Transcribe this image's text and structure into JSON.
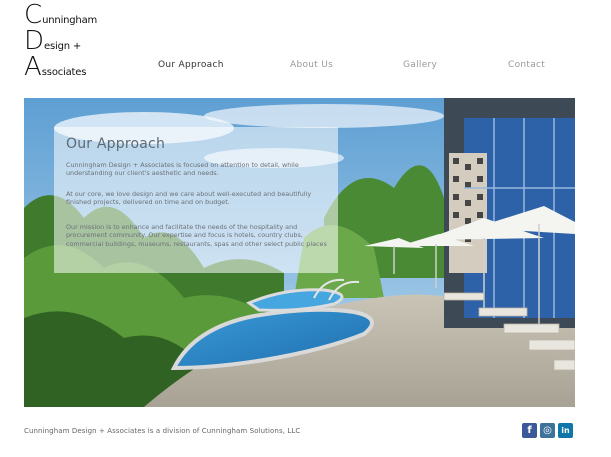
{
  "logo": {
    "line1_initial": "C",
    "line1_rest": "unningham",
    "line2_initial": "D",
    "line2_rest": "esign +",
    "line3_initial": "A",
    "line3_rest": "ssociates"
  },
  "nav": {
    "items": [
      {
        "label": "Our Approach",
        "active": true
      },
      {
        "label": "About Us",
        "active": false
      },
      {
        "label": "Gallery",
        "active": false
      },
      {
        "label": "Contact",
        "active": false
      }
    ]
  },
  "hero": {
    "title": "Our Approach",
    "paragraphs": [
      "Cunningham Design + Associates is focused on attention to detail, while understanding our client's aesthetic and needs.",
      "At our core, we love design and we care about well-executed and beautifully finished projects, delivered on time and on budget.",
      "Our mission is to enhance and facilitate the needs of the hospitality and procurement community. Our expertise and focus is hotels, country clubs, commercial buildings, museums, restaurants, spas and other select public places"
    ]
  },
  "footer": {
    "text": "Cunningham Design + Associates is a division of Cunningham Solutions, LLC",
    "social": [
      {
        "icon": "facebook-icon",
        "glyph": "f"
      },
      {
        "icon": "instagram-icon",
        "glyph": "◎"
      },
      {
        "icon": "linkedin-icon",
        "glyph": "in"
      }
    ]
  },
  "colors": {
    "nav_active": "#333333",
    "nav_inactive": "#9a9a9a",
    "overlay_text": "#5c6a75",
    "facebook": "#3b5998",
    "instagram": "#3f729b",
    "linkedin": "#0e76a8"
  }
}
